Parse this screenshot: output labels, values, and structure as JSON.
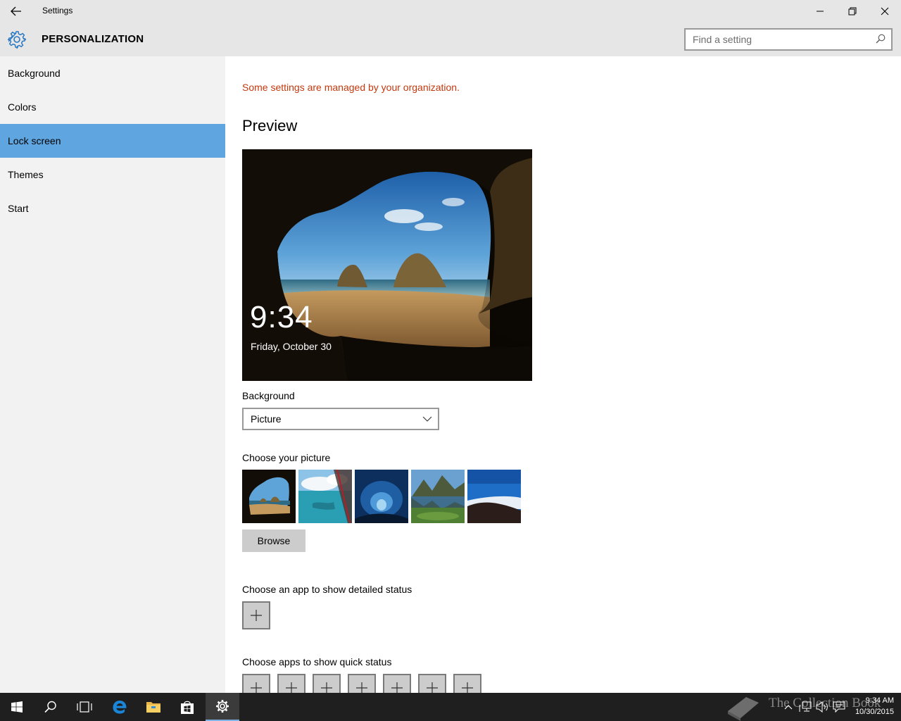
{
  "window": {
    "title": "Settings"
  },
  "header": {
    "section": "PERSONALIZATION",
    "search_placeholder": "Find a setting"
  },
  "sidebar": {
    "items": [
      {
        "label": "Background",
        "active": false
      },
      {
        "label": "Colors",
        "active": false
      },
      {
        "label": "Lock screen",
        "active": true
      },
      {
        "label": "Themes",
        "active": false
      },
      {
        "label": "Start",
        "active": false
      }
    ]
  },
  "main": {
    "managed_notice": "Some settings are managed by your organization.",
    "preview_heading": "Preview",
    "preview": {
      "time": "9:34",
      "date": "Friday, October 30"
    },
    "background_label": "Background",
    "background_value": "Picture",
    "choose_picture_label": "Choose your picture",
    "browse_label": "Browse",
    "detailed_status_label": "Choose an app to show detailed status",
    "quick_status_label": "Choose apps to show quick status"
  },
  "taskbar": {
    "clock_time": "9:34 AM",
    "clock_date": "10/30/2015",
    "watermark": "The Collection Book"
  },
  "colors": {
    "accent": "#5fa5e0",
    "warning": "#c4380e",
    "gear": "#2b79c2"
  }
}
